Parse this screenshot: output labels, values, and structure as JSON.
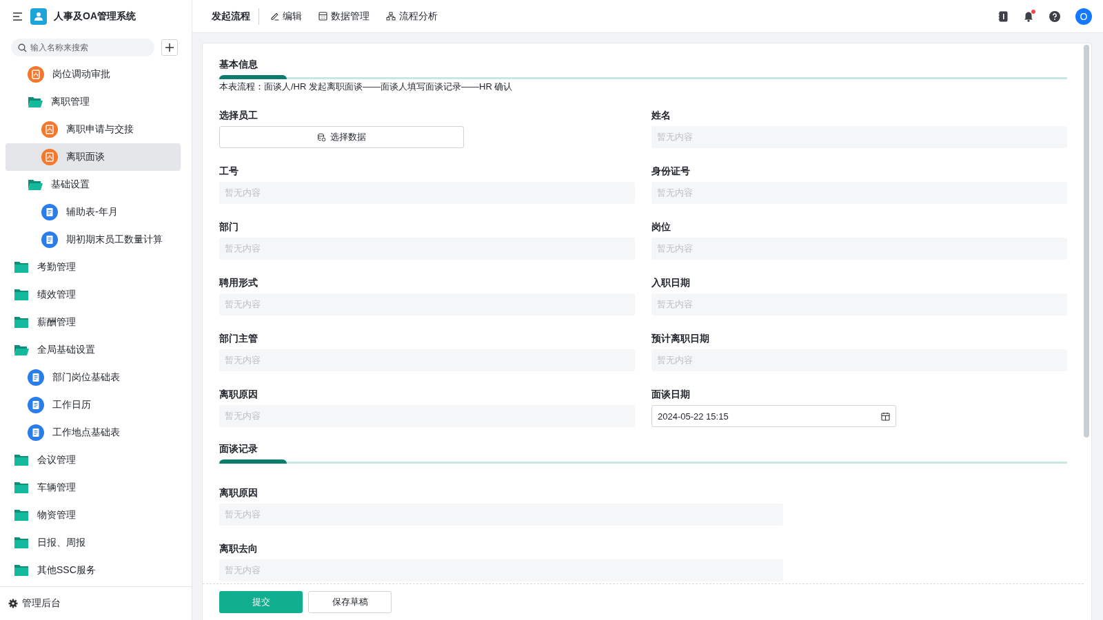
{
  "app": {
    "title": "人事及OA管理系统"
  },
  "header": {
    "tabs": [
      {
        "label": "发起流程",
        "selected": true
      },
      {
        "label": "编辑",
        "selected": false
      },
      {
        "label": "数据管理",
        "selected": false
      },
      {
        "label": "流程分析",
        "selected": false
      }
    ],
    "notification_badge": true,
    "avatar": "O"
  },
  "sidebar": {
    "search": {
      "placeholder": "输入名称来搜索"
    },
    "continued_items": [
      {
        "label": "岗位调动审批",
        "kind": "flow",
        "selected": false
      },
      {
        "label": "离职管理",
        "kind": "folder",
        "expanded": true,
        "selected": false,
        "children": [
          {
            "label": "离职申请与交接",
            "kind": "flow",
            "selected": false
          },
          {
            "label": "离职面谈",
            "kind": "flow",
            "selected": true
          }
        ]
      },
      {
        "label": "基础设置",
        "kind": "folder",
        "expanded": true,
        "selected": false,
        "children": [
          {
            "label": "辅助表-年月",
            "kind": "form",
            "selected": false
          },
          {
            "label": "期初期末员工数量计算",
            "kind": "form",
            "selected": false
          }
        ]
      }
    ],
    "items": [
      {
        "label": "考勤管理",
        "kind": "folder",
        "expanded": false,
        "selected": false
      },
      {
        "label": "绩效管理",
        "kind": "folder",
        "expanded": false,
        "selected": false
      },
      {
        "label": "薪酬管理",
        "kind": "folder",
        "expanded": false,
        "selected": false
      },
      {
        "label": "全局基础设置",
        "kind": "folder",
        "expanded": true,
        "selected": false,
        "children": [
          {
            "label": "部门岗位基础表",
            "kind": "form",
            "selected": false
          },
          {
            "label": "工作日历",
            "kind": "form",
            "selected": false
          },
          {
            "label": "工作地点基础表",
            "kind": "form",
            "selected": false
          }
        ]
      },
      {
        "label": "会议管理",
        "kind": "folder",
        "expanded": false,
        "selected": false
      },
      {
        "label": "车辆管理",
        "kind": "folder",
        "expanded": false,
        "selected": false
      },
      {
        "label": "物资管理",
        "kind": "folder",
        "expanded": false,
        "selected": false
      },
      {
        "label": "日报、周报",
        "kind": "folder",
        "expanded": false,
        "selected": false
      },
      {
        "label": "其他SSC服务",
        "kind": "folder",
        "expanded": false,
        "selected": false
      }
    ],
    "footer": "管理后台"
  },
  "form": {
    "sections": [
      {
        "title": "基本信息",
        "description": "本表流程：面谈人/HR 发起离职面谈——面谈人填写面谈记录——HR 确认",
        "kind": "two-column",
        "fields": [
          {
            "label": "选择员工",
            "kind": "select",
            "button": "选择数据"
          },
          {
            "label": "姓名",
            "kind": "readonly",
            "placeholder": "暂无内容"
          },
          {
            "label": "工号",
            "kind": "readonly",
            "placeholder": "暂无内容"
          },
          {
            "label": "身份证号",
            "kind": "readonly",
            "placeholder": "暂无内容"
          },
          {
            "label": "部门",
            "kind": "readonly",
            "placeholder": "暂无内容"
          },
          {
            "label": "岗位",
            "kind": "readonly",
            "placeholder": "暂无内容"
          },
          {
            "label": "聘用形式",
            "kind": "readonly",
            "placeholder": "暂无内容"
          },
          {
            "label": "入职日期",
            "kind": "readonly",
            "placeholder": "暂无内容"
          },
          {
            "label": "部门主管",
            "kind": "readonly",
            "placeholder": "暂无内容"
          },
          {
            "label": "预计离职日期",
            "kind": "readonly",
            "placeholder": "暂无内容"
          },
          {
            "label": "离职原因",
            "kind": "readonly",
            "placeholder": "暂无内容"
          },
          {
            "label": "面谈日期",
            "kind": "datetime",
            "value": "2024-05-22 15:15"
          }
        ]
      },
      {
        "title": "面谈记录",
        "kind": "wide",
        "fields": [
          {
            "label": "离职原因",
            "kind": "readonly",
            "placeholder": "暂无内容"
          },
          {
            "label": "离职去向",
            "kind": "readonly",
            "placeholder": "暂无内容"
          }
        ]
      }
    ],
    "buttons": [
      {
        "label": "提交",
        "kind": "primary"
      },
      {
        "label": "保存草稿",
        "kind": "secondary"
      }
    ]
  }
}
